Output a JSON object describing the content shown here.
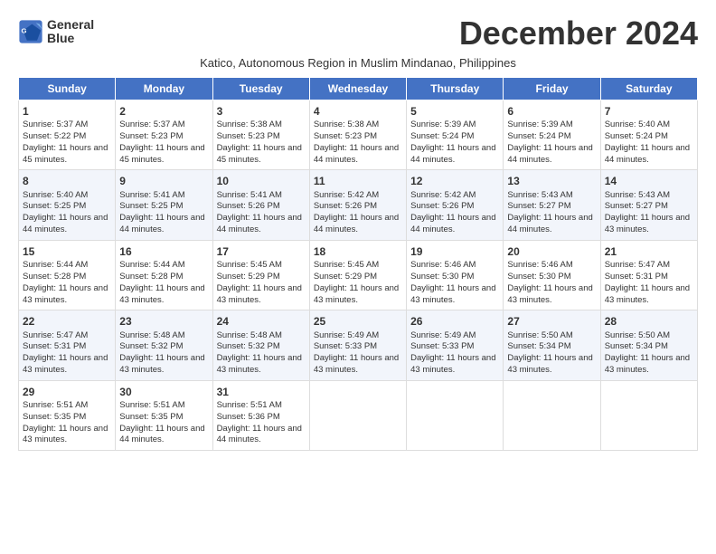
{
  "header": {
    "logo_line1": "General",
    "logo_line2": "Blue",
    "month_title": "December 2024",
    "subtitle": "Katico, Autonomous Region in Muslim Mindanao, Philippines"
  },
  "days_of_week": [
    "Sunday",
    "Monday",
    "Tuesday",
    "Wednesday",
    "Thursday",
    "Friday",
    "Saturday"
  ],
  "weeks": [
    [
      {
        "day": "1",
        "content": "Sunrise: 5:37 AM\nSunset: 5:22 PM\nDaylight: 11 hours and 45 minutes."
      },
      {
        "day": "2",
        "content": "Sunrise: 5:37 AM\nSunset: 5:23 PM\nDaylight: 11 hours and 45 minutes."
      },
      {
        "day": "3",
        "content": "Sunrise: 5:38 AM\nSunset: 5:23 PM\nDaylight: 11 hours and 45 minutes."
      },
      {
        "day": "4",
        "content": "Sunrise: 5:38 AM\nSunset: 5:23 PM\nDaylight: 11 hours and 44 minutes."
      },
      {
        "day": "5",
        "content": "Sunrise: 5:39 AM\nSunset: 5:24 PM\nDaylight: 11 hours and 44 minutes."
      },
      {
        "day": "6",
        "content": "Sunrise: 5:39 AM\nSunset: 5:24 PM\nDaylight: 11 hours and 44 minutes."
      },
      {
        "day": "7",
        "content": "Sunrise: 5:40 AM\nSunset: 5:24 PM\nDaylight: 11 hours and 44 minutes."
      }
    ],
    [
      {
        "day": "8",
        "content": "Sunrise: 5:40 AM\nSunset: 5:25 PM\nDaylight: 11 hours and 44 minutes."
      },
      {
        "day": "9",
        "content": "Sunrise: 5:41 AM\nSunset: 5:25 PM\nDaylight: 11 hours and 44 minutes."
      },
      {
        "day": "10",
        "content": "Sunrise: 5:41 AM\nSunset: 5:26 PM\nDaylight: 11 hours and 44 minutes."
      },
      {
        "day": "11",
        "content": "Sunrise: 5:42 AM\nSunset: 5:26 PM\nDaylight: 11 hours and 44 minutes."
      },
      {
        "day": "12",
        "content": "Sunrise: 5:42 AM\nSunset: 5:26 PM\nDaylight: 11 hours and 44 minutes."
      },
      {
        "day": "13",
        "content": "Sunrise: 5:43 AM\nSunset: 5:27 PM\nDaylight: 11 hours and 44 minutes."
      },
      {
        "day": "14",
        "content": "Sunrise: 5:43 AM\nSunset: 5:27 PM\nDaylight: 11 hours and 43 minutes."
      }
    ],
    [
      {
        "day": "15",
        "content": "Sunrise: 5:44 AM\nSunset: 5:28 PM\nDaylight: 11 hours and 43 minutes."
      },
      {
        "day": "16",
        "content": "Sunrise: 5:44 AM\nSunset: 5:28 PM\nDaylight: 11 hours and 43 minutes."
      },
      {
        "day": "17",
        "content": "Sunrise: 5:45 AM\nSunset: 5:29 PM\nDaylight: 11 hours and 43 minutes."
      },
      {
        "day": "18",
        "content": "Sunrise: 5:45 AM\nSunset: 5:29 PM\nDaylight: 11 hours and 43 minutes."
      },
      {
        "day": "19",
        "content": "Sunrise: 5:46 AM\nSunset: 5:30 PM\nDaylight: 11 hours and 43 minutes."
      },
      {
        "day": "20",
        "content": "Sunrise: 5:46 AM\nSunset: 5:30 PM\nDaylight: 11 hours and 43 minutes."
      },
      {
        "day": "21",
        "content": "Sunrise: 5:47 AM\nSunset: 5:31 PM\nDaylight: 11 hours and 43 minutes."
      }
    ],
    [
      {
        "day": "22",
        "content": "Sunrise: 5:47 AM\nSunset: 5:31 PM\nDaylight: 11 hours and 43 minutes."
      },
      {
        "day": "23",
        "content": "Sunrise: 5:48 AM\nSunset: 5:32 PM\nDaylight: 11 hours and 43 minutes."
      },
      {
        "day": "24",
        "content": "Sunrise: 5:48 AM\nSunset: 5:32 PM\nDaylight: 11 hours and 43 minutes."
      },
      {
        "day": "25",
        "content": "Sunrise: 5:49 AM\nSunset: 5:33 PM\nDaylight: 11 hours and 43 minutes."
      },
      {
        "day": "26",
        "content": "Sunrise: 5:49 AM\nSunset: 5:33 PM\nDaylight: 11 hours and 43 minutes."
      },
      {
        "day": "27",
        "content": "Sunrise: 5:50 AM\nSunset: 5:34 PM\nDaylight: 11 hours and 43 minutes."
      },
      {
        "day": "28",
        "content": "Sunrise: 5:50 AM\nSunset: 5:34 PM\nDaylight: 11 hours and 43 minutes."
      }
    ],
    [
      {
        "day": "29",
        "content": "Sunrise: 5:51 AM\nSunset: 5:35 PM\nDaylight: 11 hours and 43 minutes."
      },
      {
        "day": "30",
        "content": "Sunrise: 5:51 AM\nSunset: 5:35 PM\nDaylight: 11 hours and 44 minutes."
      },
      {
        "day": "31",
        "content": "Sunrise: 5:51 AM\nSunset: 5:36 PM\nDaylight: 11 hours and 44 minutes."
      },
      {
        "day": "",
        "content": ""
      },
      {
        "day": "",
        "content": ""
      },
      {
        "day": "",
        "content": ""
      },
      {
        "day": "",
        "content": ""
      }
    ]
  ]
}
